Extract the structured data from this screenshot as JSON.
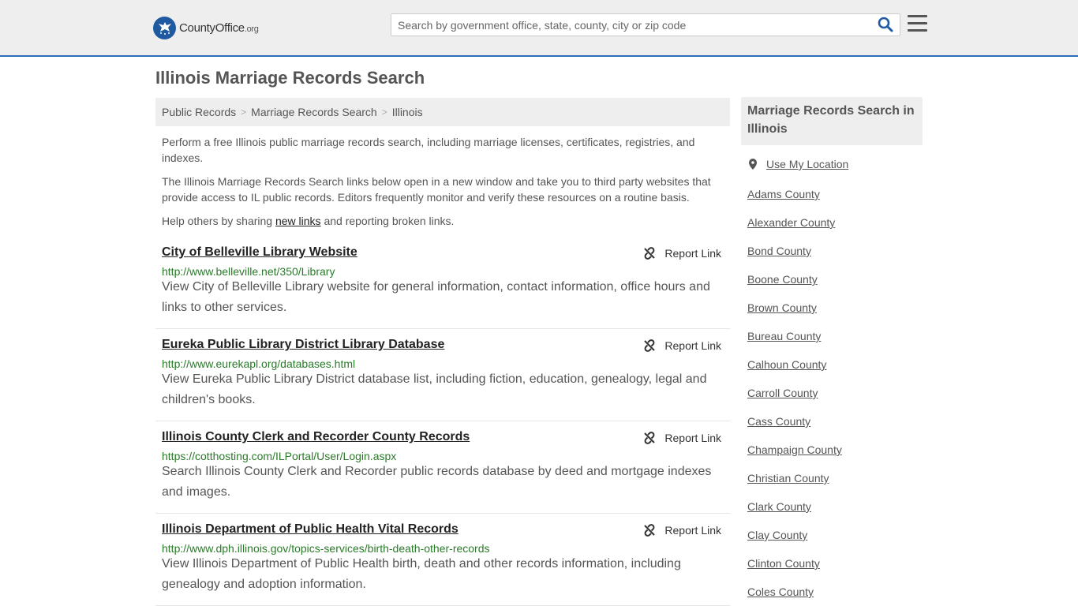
{
  "header": {
    "logo_name": "County",
    "logo_bold": "Office",
    "logo_tld": ".org",
    "search_placeholder": "Search by government office, state, county, city or zip code",
    "search_icon": "search-icon",
    "menu_icon": "hamburger-menu-icon",
    "accent_color": "#2a6ebb"
  },
  "page": {
    "title": "Illinois Marriage Records Search",
    "breadcrumb": [
      "Public Records",
      "Marriage Records Search",
      "Illinois"
    ],
    "intro1": "Perform a free Illinois public marriage records search, including marriage licenses, certificates, registries, and indexes.",
    "intro2": "The Illinois Marriage Records Search links below open in a new window and take you to third party websites that provide access to IL public records. Editors frequently monitor and verify these resources on a routine basis.",
    "intro3_before": "Help others by sharing ",
    "intro3_link": "new links",
    "intro3_after": " and reporting broken links."
  },
  "results": [
    {
      "title": "City of Belleville Library Website",
      "url": "http://www.belleville.net/350/Library",
      "description": "View City of Belleville Library website for general information, contact information, office hours and links to other services.",
      "report_label": "Report Link"
    },
    {
      "title": "Eureka Public Library District Library Database",
      "url": "http://www.eurekapl.org/databases.html",
      "description": "View Eureka Public Library District database list, including fiction, education, genealogy, legal and children's books.",
      "report_label": "Report Link"
    },
    {
      "title": "Illinois County Clerk and Recorder County Records",
      "url": "https://cotthosting.com/ILPortal/User/Login.aspx",
      "description": "Search Illinois County Clerk and Recorder public records database by deed and mortgage indexes and images.",
      "report_label": "Report Link"
    },
    {
      "title": "Illinois Department of Public Health Vital Records",
      "url": "http://www.dph.illinois.gov/topics-services/birth-death-other-records",
      "description": "View Illinois Department of Public Health birth, death and other records information, including genealogy and adoption information.",
      "report_label": "Report Link"
    }
  ],
  "sidebar": {
    "heading": "Marriage Records Search in Illinois",
    "location_label": "Use My Location",
    "counties": [
      "Adams County",
      "Alexander County",
      "Bond County",
      "Boone County",
      "Brown County",
      "Bureau County",
      "Calhoun County",
      "Carroll County",
      "Cass County",
      "Champaign County",
      "Christian County",
      "Clark County",
      "Clay County",
      "Clinton County",
      "Coles County"
    ]
  }
}
